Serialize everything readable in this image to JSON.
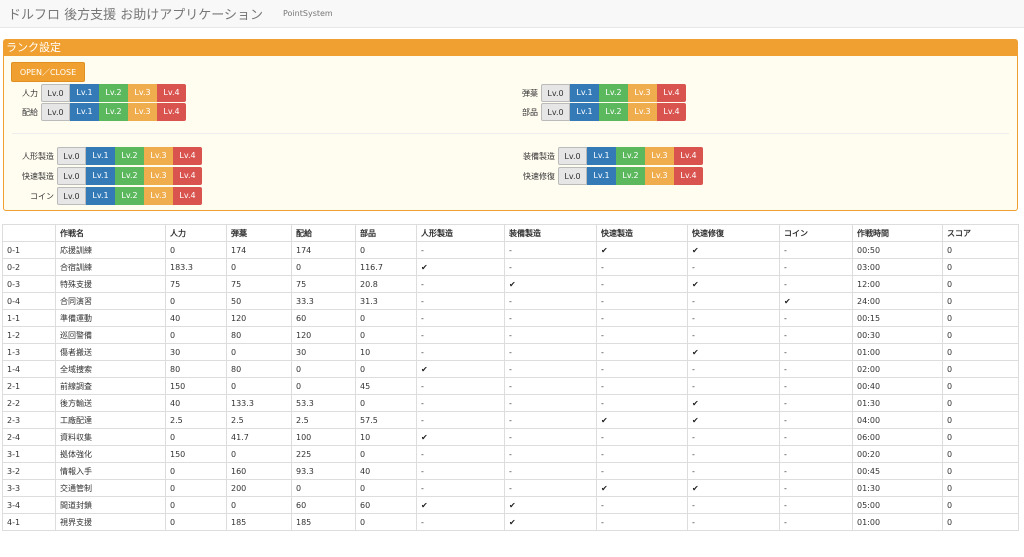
{
  "header": {
    "title": "ドルフロ 後方支援 お助けアプリケーション",
    "nav_link": "PointSystem"
  },
  "rank_panel": {
    "title": "ランク設定",
    "toggle_label": "OPEN／CLOSE",
    "levels": [
      "Lv.0",
      "Lv.1",
      "Lv.2",
      "Lv.3",
      "Lv.4"
    ],
    "rows": {
      "manpower": "人力",
      "ammo": "弾薬",
      "ration": "配給",
      "parts": "部品",
      "doll_production": "人形製造",
      "equip_production": "装備製造",
      "quick_production": "快速製造",
      "quick_repair": "快速修復",
      "coin": "コイン"
    }
  },
  "table": {
    "headers": [
      "",
      "作戦名",
      "人力",
      "弾薬",
      "配給",
      "部品",
      "人形製造",
      "装備製造",
      "快速製造",
      "快速修復",
      "コイン",
      "作戦時間",
      "スコア"
    ],
    "rows": [
      [
        "0-1",
        "応援訓練",
        "0",
        "174",
        "174",
        "0",
        "-",
        "-",
        "✔",
        "✔",
        "-",
        "00:50",
        "0"
      ],
      [
        "0-2",
        "合宿訓練",
        "183.3",
        "0",
        "0",
        "116.7",
        "✔",
        "-",
        "-",
        "-",
        "-",
        "03:00",
        "0"
      ],
      [
        "0-3",
        "特殊支援",
        "75",
        "75",
        "75",
        "20.8",
        "-",
        "✔",
        "-",
        "✔",
        "-",
        "12:00",
        "0"
      ],
      [
        "0-4",
        "合同演習",
        "0",
        "50",
        "33.3",
        "31.3",
        "-",
        "-",
        "-",
        "-",
        "✔",
        "24:00",
        "0"
      ],
      [
        "1-1",
        "準備運動",
        "40",
        "120",
        "60",
        "0",
        "-",
        "-",
        "-",
        "-",
        "-",
        "00:15",
        "0"
      ],
      [
        "1-2",
        "巡回警備",
        "0",
        "80",
        "120",
        "0",
        "-",
        "-",
        "-",
        "-",
        "-",
        "00:30",
        "0"
      ],
      [
        "1-3",
        "傷者搬送",
        "30",
        "0",
        "30",
        "10",
        "-",
        "-",
        "-",
        "✔",
        "-",
        "01:00",
        "0"
      ],
      [
        "1-4",
        "全域捜索",
        "80",
        "80",
        "0",
        "0",
        "✔",
        "-",
        "-",
        "-",
        "-",
        "02:00",
        "0"
      ],
      [
        "2-1",
        "前線調査",
        "150",
        "0",
        "0",
        "45",
        "-",
        "-",
        "-",
        "-",
        "-",
        "00:40",
        "0"
      ],
      [
        "2-2",
        "後方輸送",
        "40",
        "133.3",
        "53.3",
        "0",
        "-",
        "-",
        "-",
        "✔",
        "-",
        "01:30",
        "0"
      ],
      [
        "2-3",
        "工廠配達",
        "2.5",
        "2.5",
        "2.5",
        "57.5",
        "-",
        "-",
        "✔",
        "✔",
        "-",
        "04:00",
        "0"
      ],
      [
        "2-4",
        "資料収集",
        "0",
        "41.7",
        "100",
        "10",
        "✔",
        "-",
        "-",
        "-",
        "-",
        "06:00",
        "0"
      ],
      [
        "3-1",
        "拠体強化",
        "150",
        "0",
        "225",
        "0",
        "-",
        "-",
        "-",
        "-",
        "-",
        "00:20",
        "0"
      ],
      [
        "3-2",
        "情報入手",
        "0",
        "160",
        "93.3",
        "40",
        "-",
        "-",
        "-",
        "-",
        "-",
        "00:45",
        "0"
      ],
      [
        "3-3",
        "交通管制",
        "0",
        "200",
        "0",
        "0",
        "-",
        "-",
        "✔",
        "✔",
        "-",
        "01:30",
        "0"
      ],
      [
        "3-4",
        "間道封鎖",
        "0",
        "0",
        "60",
        "60",
        "✔",
        "✔",
        "-",
        "-",
        "-",
        "05:00",
        "0"
      ],
      [
        "4-1",
        "視界支援",
        "0",
        "185",
        "185",
        "0",
        "-",
        "✔",
        "-",
        "-",
        "-",
        "01:00",
        "0"
      ]
    ]
  }
}
